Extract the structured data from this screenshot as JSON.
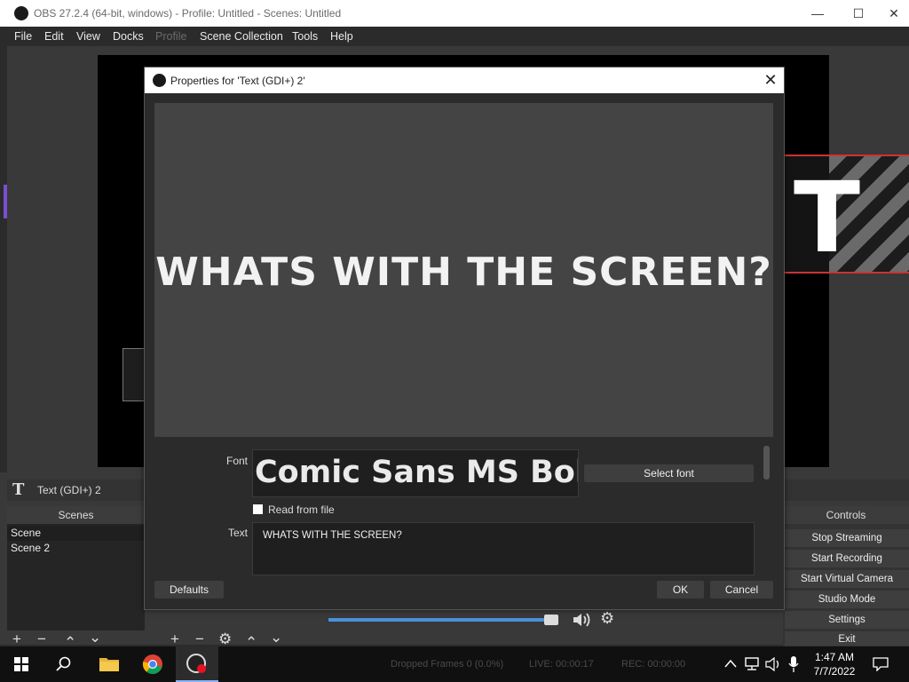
{
  "window": {
    "title": "OBS 27.2.4 (64-bit, windows) - Profile: Untitled - Scenes: Untitled",
    "minimize": "—",
    "maximize": "☐",
    "close": "✕"
  },
  "menu": [
    "File",
    "Edit",
    "View",
    "Docks",
    "Profile",
    "Scene Collection",
    "Tools",
    "Help"
  ],
  "source_bar": {
    "icon": "T",
    "label": "Text (GDI+) 2"
  },
  "scenes": {
    "header": "Scenes",
    "items": [
      "Scene",
      "Scene 2"
    ]
  },
  "dock_buttons": {
    "add": "+",
    "remove": "−",
    "up": "⌃",
    "down": "⌄",
    "settings": "⚙"
  },
  "controls": {
    "header": "Controls",
    "buttons": [
      "Stop Streaming",
      "Start Recording",
      "Start Virtual Camera",
      "Studio Mode",
      "Settings",
      "Exit"
    ]
  },
  "mixer": {
    "volume": 0.96
  },
  "dialog": {
    "title": "Properties for 'Text (GDI+) 2'",
    "close": "✕",
    "preview_text": "WHATS WITH THE SCREEN?",
    "font_label": "Font",
    "font_value": "Comic Sans MS Bold",
    "select_font": "Select font",
    "read_from_file": "Read from file",
    "text_label": "Text",
    "text_value": "WHATS WITH THE SCREEN?",
    "defaults": "Defaults",
    "ok": "OK",
    "cancel": "Cancel"
  },
  "status": {
    "dropped": "Dropped Frames 0 (0.0%)",
    "live": "LIVE: 00:00:17",
    "rec": "REC: 00:00:00"
  },
  "taskbar": {
    "time": "1:47 AM",
    "date": "7/7/2022"
  },
  "colors": {
    "accent": "#4a90d9",
    "recording": "#e81123",
    "source_outline": "#cc3333"
  }
}
